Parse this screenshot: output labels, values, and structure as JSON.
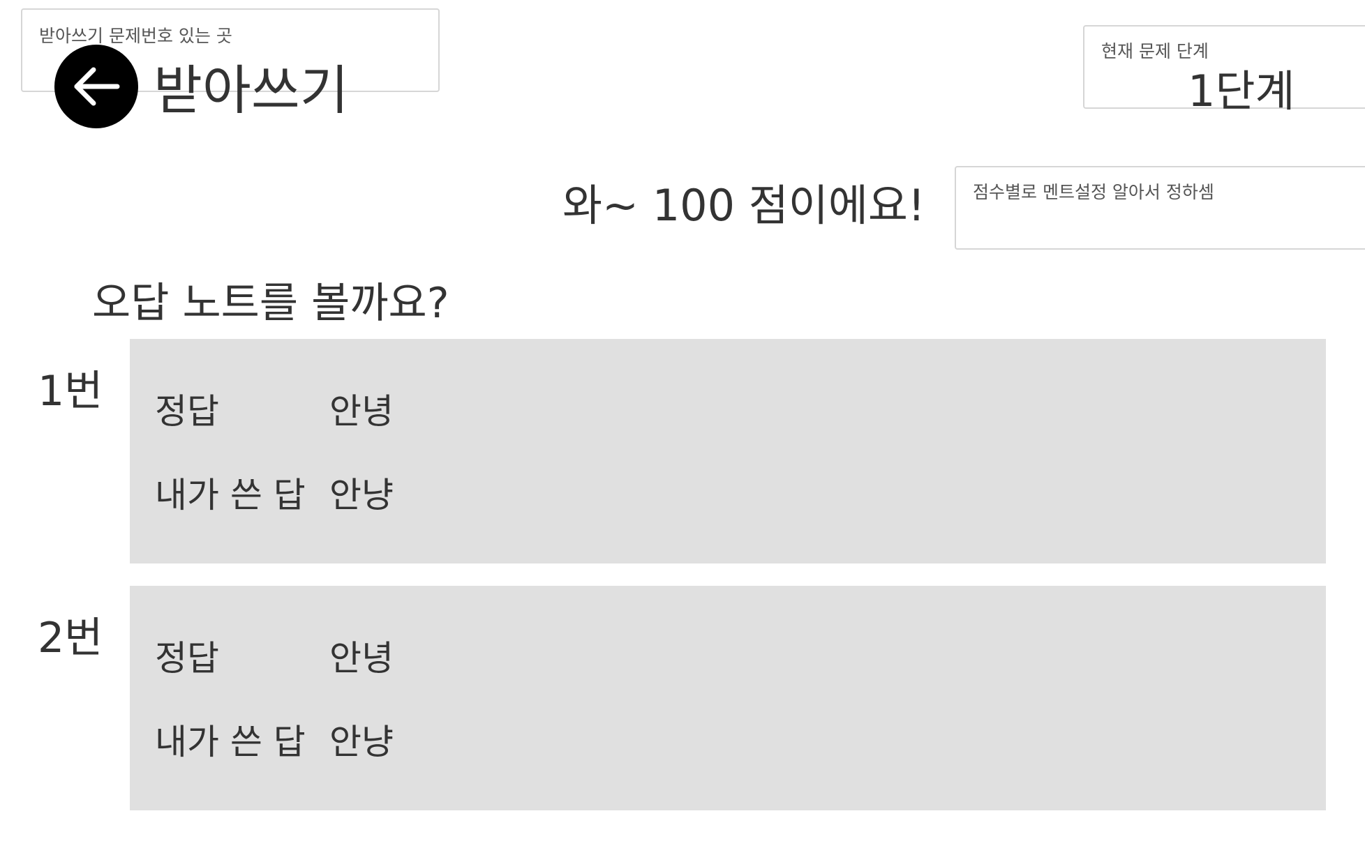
{
  "annotations": {
    "problem_number_note": "받아쓰기 문제번호 있는 곳",
    "stage_note": "현재 문제 단계",
    "comment_note": "점수별로 멘트설정 알아서 정하셈"
  },
  "header": {
    "title": "받아쓰기",
    "back_icon": "arrow-left-icon",
    "stage_value": "1단계"
  },
  "result": {
    "score_message": "와~ 100 점이에요!",
    "review_question": "오답 노트를 볼까요?"
  },
  "wrong_answers": [
    {
      "number": "1번",
      "correct_label": "정답",
      "correct_value": "안녕",
      "mine_label": "내가 쓴 답",
      "mine_value": "안냥"
    },
    {
      "number": "2번",
      "correct_label": "정답",
      "correct_value": "안녕",
      "mine_label": "내가 쓴 답",
      "mine_value": "안냥"
    }
  ],
  "colors": {
    "background": "#ffffff",
    "card_background": "#e0e0e0",
    "text": "#333333",
    "back_button": "#000000"
  }
}
